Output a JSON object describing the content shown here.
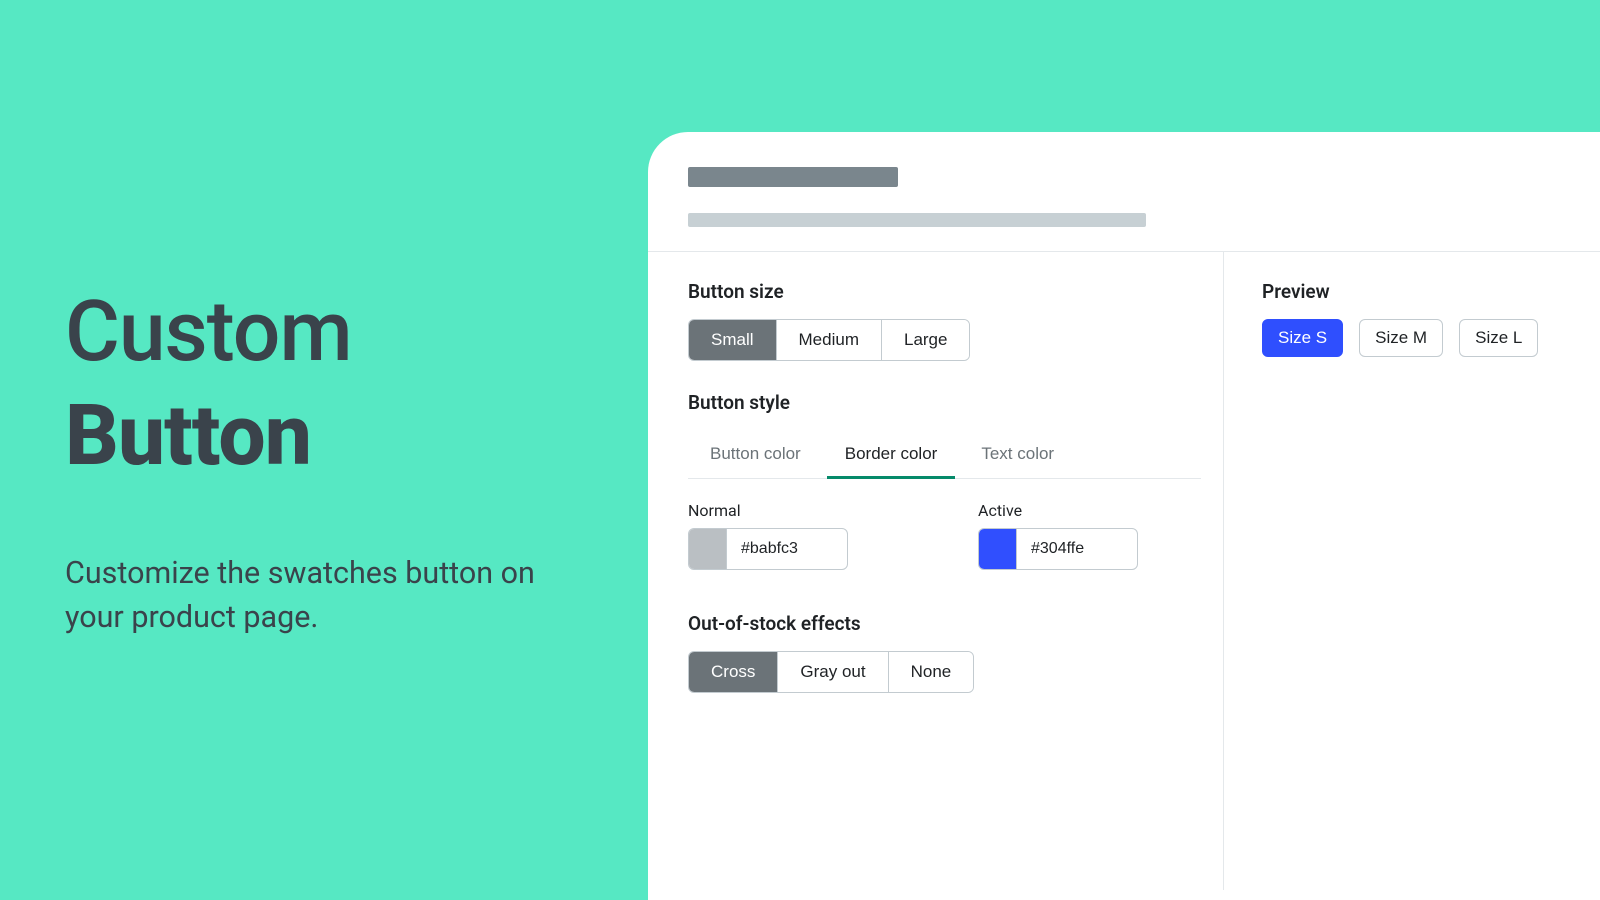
{
  "hero": {
    "title_top": "Custom",
    "title_bottom": "Button",
    "subtitle": "Customize the swatches button on your product page."
  },
  "colors": {
    "background": "#56e8c3",
    "normal_border": "#babfc3",
    "active_border": "#304ffe"
  },
  "settings": {
    "button_size": {
      "label": "Button size",
      "options": [
        "Small",
        "Medium",
        "Large"
      ],
      "selected": "Small"
    },
    "button_style": {
      "label": "Button style",
      "tabs": [
        "Button color",
        "Border color",
        "Text color"
      ],
      "selected_tab": "Border color",
      "normal": {
        "label": "Normal",
        "value": "#babfc3"
      },
      "active": {
        "label": "Active",
        "value": "#304ffe"
      }
    },
    "oos": {
      "label": "Out-of-stock effects",
      "options": [
        "Cross",
        "Gray out",
        "None"
      ],
      "selected": "Cross"
    }
  },
  "preview": {
    "label": "Preview",
    "buttons": [
      "Size S",
      "Size M",
      "Size L"
    ],
    "selected": "Size S"
  }
}
